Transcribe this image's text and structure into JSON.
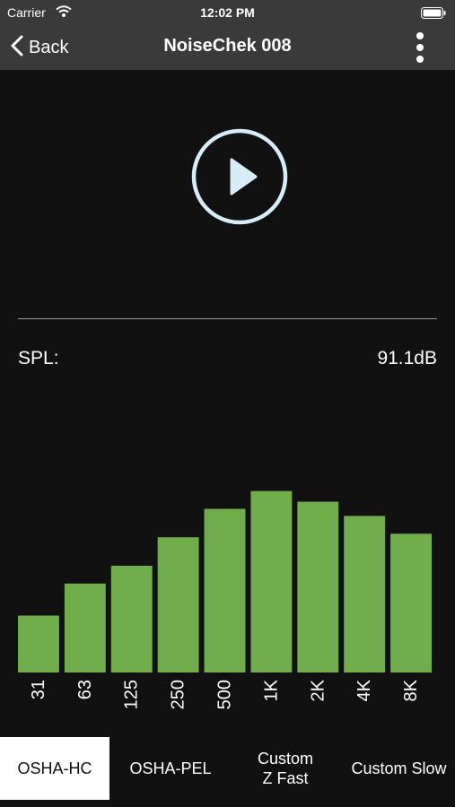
{
  "status_bar": {
    "carrier": "Carrier",
    "time": "12:02 PM"
  },
  "nav": {
    "back_label": "Back",
    "title": "NoiseChek 008"
  },
  "spl": {
    "label": "SPL:",
    "value": "91.1dB"
  },
  "colors": {
    "bar": "#72ad4c",
    "background": "#111111",
    "nav": "#3a3a3a",
    "play": "#d6ecf7"
  },
  "chart_data": {
    "type": "bar",
    "categories": [
      "31",
      "63",
      "125",
      "250",
      "500",
      "1K",
      "2K",
      "4K",
      "8K"
    ],
    "values": [
      73,
      82,
      87,
      95,
      103,
      108,
      105,
      101,
      96
    ],
    "ylim": [
      57,
      120
    ],
    "grid": false,
    "xlabel": "",
    "ylabel": ""
  },
  "tabs": [
    {
      "label": "OSHA-HC",
      "selected": true
    },
    {
      "label": "OSHA-PEL",
      "selected": false
    },
    {
      "label": "Custom\nZ Fast",
      "selected": false
    },
    {
      "label": "Custom Slow",
      "selected": false
    }
  ]
}
